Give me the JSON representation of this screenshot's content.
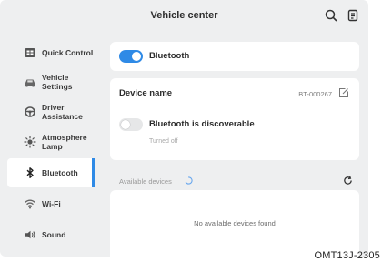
{
  "header": {
    "title": "Vehicle center",
    "icons": [
      "search-icon",
      "document-icon"
    ]
  },
  "sidebar": {
    "items": [
      {
        "label": "Quick Control",
        "icon": "quick-control-icon",
        "active": false
      },
      {
        "label": "Vehicle Settings",
        "icon": "car-icon",
        "active": false
      },
      {
        "label": "Driver Assistance",
        "icon": "steering-wheel-icon",
        "active": false
      },
      {
        "label": "Atmosphere Lamp",
        "icon": "sun-lamp-icon",
        "active": false
      },
      {
        "label": "Bluetooth",
        "icon": "bluetooth-icon",
        "active": true
      },
      {
        "label": "Wi-Fi",
        "icon": "wifi-icon",
        "active": false
      },
      {
        "label": "Sound",
        "icon": "speaker-icon",
        "active": false
      }
    ]
  },
  "bluetooth_card": {
    "label": "Bluetooth",
    "enabled": true
  },
  "device_card": {
    "name_label": "Device name",
    "name_value": "BT-000267",
    "discoverable_label": "Bluetooth is discoverable",
    "discoverable_enabled": false,
    "discoverable_status": "Turned off"
  },
  "available": {
    "label": "Available devices",
    "empty_text": "No available devices found"
  },
  "colors": {
    "accent": "#2f8ae6",
    "background": "#eeeff0",
    "card": "#ffffff"
  },
  "watermark": "OMT13J-2305"
}
